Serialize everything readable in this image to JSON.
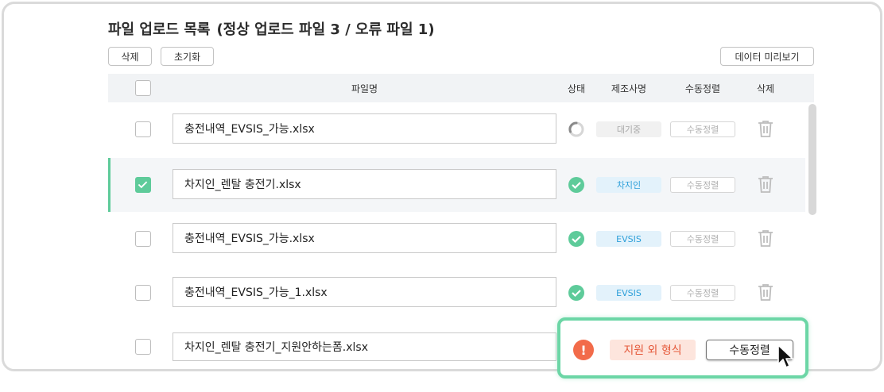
{
  "header": {
    "title": "파일 업로드 목록",
    "subtitle": "(정상 업로드 파일 3 / 오류 파일 1)"
  },
  "toolbar": {
    "delete_label": "삭제",
    "reset_label": "초기화",
    "preview_label": "데이터 미리보기"
  },
  "table": {
    "columns": [
      "파일명",
      "상태",
      "제조사명",
      "수동정렬",
      "삭제"
    ],
    "rows": [
      {
        "filename": "충전내역_EVSIS_가능.xlsx",
        "status": "loading",
        "maker": "대기중",
        "manual": "수동정렬",
        "checked": false
      },
      {
        "filename": "차지인_렌탈 충전기.xlsx",
        "status": "ok",
        "maker": "차지인",
        "manual": "수동정렬",
        "checked": true
      },
      {
        "filename": "충전내역_EVSIS_가능.xlsx",
        "status": "ok",
        "maker": "EVSIS",
        "manual": "수동정렬",
        "checked": false
      },
      {
        "filename": "충전내역_EVSIS_가능_1.xlsx",
        "status": "ok",
        "maker": "EVSIS",
        "manual": "수동정렬",
        "checked": false
      },
      {
        "filename": "차지인_렌탈 충전기_지원안하는폼.xlsx",
        "status": "error",
        "maker": "",
        "manual": "",
        "checked": false
      }
    ]
  },
  "error_popup": {
    "icon": "!",
    "badge": "지원 외 형식",
    "button": "수동정렬"
  },
  "colors": {
    "accent_green": "#5ecb9a",
    "tag_blue": "#2c9fd9",
    "error_red": "#f26b4a"
  }
}
